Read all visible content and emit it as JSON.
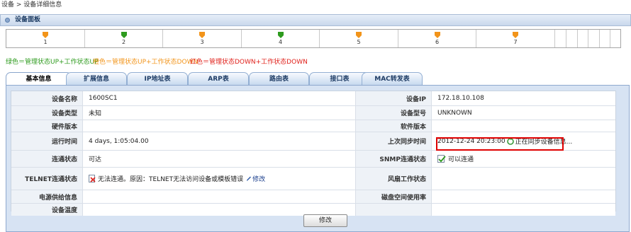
{
  "breadcrumb": "设备 > 设备详细信息",
  "panel_title": "设备面板",
  "ports": [
    {
      "num": "1",
      "status": "orange"
    },
    {
      "num": "2",
      "status": "green"
    },
    {
      "num": "3",
      "status": "orange"
    },
    {
      "num": "4",
      "status": "green"
    },
    {
      "num": "5",
      "status": "orange"
    },
    {
      "num": "6",
      "status": "orange"
    },
    {
      "num": "7",
      "status": "orange"
    }
  ],
  "colors": {
    "green": "#2e9b1e",
    "orange": "#f2941a",
    "red": "#e0201a"
  },
  "legend": {
    "green": "绿色＝管理状态UP+工作状态UP",
    "orange": "橙色＝管理状态UP+工作状态DOWN",
    "red": "红色＝管理状态DOWN+工作状态DOWN"
  },
  "tabs": [
    "基本信息",
    "扩展信息",
    "IP地址表",
    "ARP表",
    "路由表",
    "接口表",
    "MAC转发表"
  ],
  "fields": {
    "device_name_label": "设备名称",
    "device_name": "1600SC1",
    "device_ip_label": "设备IP",
    "device_ip": "172.18.10.108",
    "device_type_label": "设备类型",
    "device_type": "未知",
    "device_model_label": "设备型号",
    "device_model": "UNKNOWN",
    "hw_ver_label": "硬件版本",
    "hw_ver": "",
    "sw_ver_label": "软件版本",
    "sw_ver": "",
    "uptime_label": "运行时间",
    "uptime": "4 days, 1:05:04.00",
    "last_sync_label": "上次同步时间",
    "last_sync": "2012-12-24 20:23:00",
    "syncing_text": "正在同步设备信息...",
    "conn_label": "连通状态",
    "conn": "可达",
    "snmp_label": "SNMP连通状态",
    "snmp": "可以连通",
    "telnet_label": "TELNET连通状态",
    "telnet": "无法连通。原因：TELNET无法访问设备或模板错误",
    "edit_link": "修改",
    "fan_label": "风扇工作状态",
    "fan": "",
    "power_label": "电源供给信息",
    "power": "",
    "disk_label": "磁盘空间使用率",
    "disk": "",
    "temp_label": "设备温度",
    "temp": ""
  },
  "modify_button": "修改"
}
